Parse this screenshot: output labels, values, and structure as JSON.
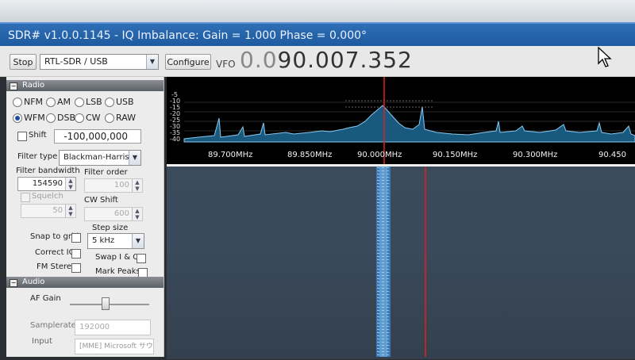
{
  "window": {
    "title": "SDR# v1.0.0.1145 - IQ Imbalance: Gain = 1.000 Phase = 0.000°"
  },
  "toolbar": {
    "stop_label": "Stop",
    "device": "RTL-SDR / USB",
    "configure_label": "Configure",
    "vfo_label": "VFO",
    "vfo_dim": "0.0",
    "vfo_value": "90.007.352"
  },
  "radio": {
    "header": "Radio",
    "modes": [
      "NFM",
      "AM",
      "LSB",
      "USB",
      "WFM",
      "DSB",
      "CW",
      "RAW"
    ],
    "selected_mode": "WFM",
    "shift_label": "Shift",
    "shift_value": "-100,000,000",
    "filter_type_label": "Filter type",
    "filter_type_value": "Blackman-Harris",
    "filter_bandwidth_label": "Filter bandwidth",
    "filter_bandwidth_value": "154590",
    "filter_order_label": "Filter order",
    "filter_order_value": "100",
    "squelch_label": "Squelch",
    "squelch_value": "50",
    "cw_shift_label": "CW Shift",
    "cw_shift_value": "600",
    "snap_to_grid_label": "Snap to grid",
    "step_size_label": "Step size",
    "step_size_value": "5 kHz",
    "correct_iq_label": "Correct IQ",
    "swap_iq_label": "Swap I & Q",
    "fm_stereo_label": "FM Stereo",
    "mark_peaks_label": "Mark Peaks"
  },
  "audio": {
    "header": "Audio",
    "af_gain_label": "AF Gain",
    "samplerate_label": "Samplerate",
    "samplerate_value": "192000",
    "input_label": "Input",
    "input_value": "[MME] Microsoft サウ"
  },
  "spectrum": {
    "db_scale": [
      "-5",
      "-10",
      "-15",
      "-20",
      "-25",
      "-30",
      "-35",
      "-40",
      "-45",
      "-50"
    ],
    "frequencies": [
      "89.700MHz",
      "89.850MHz",
      "90.000MHz",
      "90.150MHz",
      "90.300MHz",
      "90.450"
    ]
  },
  "colors": {
    "title_bar": "#1e5aa0",
    "spectrum_trace": "#7fd0ff",
    "tuning_line": "#e02020",
    "waterfall_bg": "#3a4a5c"
  }
}
